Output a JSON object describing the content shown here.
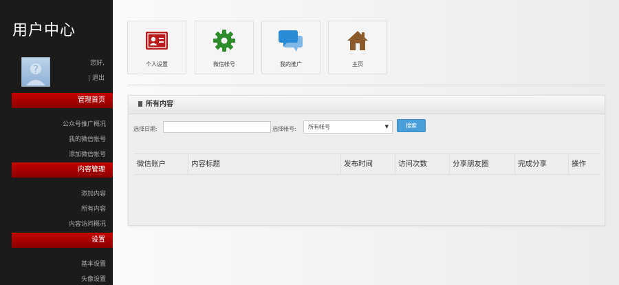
{
  "sidebar": {
    "title": "用户中心",
    "greeting": "您好,",
    "logout": "| 退出",
    "sections": [
      {
        "label": "管理首页",
        "items": [
          "公众号推广概况",
          "我的微信帐号",
          "添加微信帐号"
        ]
      },
      {
        "label": "内容管理",
        "items": [
          "添加内容",
          "所有内容",
          "内容访问概况"
        ]
      },
      {
        "label": "设置",
        "items": [
          "基本设置",
          "头像设置"
        ]
      }
    ]
  },
  "tiles": [
    {
      "label": "个人设置",
      "icon": "id-card-icon",
      "color": "#b81d1d"
    },
    {
      "label": "微信帐号",
      "icon": "gear-icon",
      "color": "#2e8b2e"
    },
    {
      "label": "我的推广",
      "icon": "chat-bubbles-icon",
      "color": "#2a8bd6"
    },
    {
      "label": "主页",
      "icon": "home-icon",
      "color": "#8b5a2b"
    }
  ],
  "panel": {
    "title": "所有内容",
    "date_label": "选择日期:",
    "date_value": "",
    "account_label": "选择帐号:",
    "account_selected": "所有帐号",
    "search_button": "搜索"
  },
  "table": {
    "columns": [
      "微信账户",
      "内容标题",
      "发布时间",
      "访问次数",
      "分享朋友圈",
      "完成分享",
      "操作"
    ],
    "rows": []
  }
}
